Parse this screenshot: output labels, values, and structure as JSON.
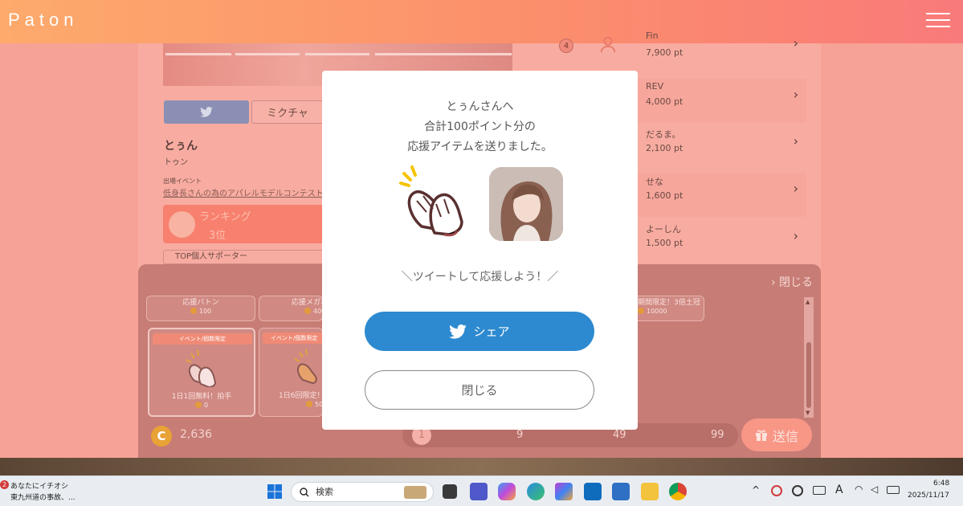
{
  "header": {
    "logo": "Paton"
  },
  "profile": {
    "mixch_label": "ミクチャ",
    "name": "とぅん",
    "name_kana": "トゥン",
    "event_label": "出場イベント",
    "event_link": "低身長さんの為のアパレルモデルコンテスト",
    "rank_title": "ランキング",
    "rank_value": "3位",
    "supporter_label": "TOP個人サポーター"
  },
  "ranking": [
    {
      "num": "4",
      "name": "Fin",
      "pt": "7,900 pt"
    },
    {
      "num": "",
      "name": "REV",
      "pt": "4,000 pt"
    },
    {
      "num": "",
      "name": "だるま。",
      "pt": "2,100 pt"
    },
    {
      "num": "",
      "name": "せな",
      "pt": "1,600 pt"
    },
    {
      "num": "",
      "name": "よーしん",
      "pt": "1,500 pt"
    }
  ],
  "panel": {
    "close_label": "閉じる",
    "items": [
      {
        "name": "応援バトン",
        "cost": "100"
      },
      {
        "name": "応援メガホン",
        "cost": "400"
      },
      {
        "name": "期間限定！3倍土冠",
        "cost": "10000"
      },
      {
        "name": "1日1回無料！拍手",
        "cost": "0",
        "tag": "イベント/個数限定"
      },
      {
        "name": "1日6回限定！",
        "cost": "50",
        "tag": "イベント/個数限定"
      }
    ],
    "balance": "2,636",
    "coin_symbol": "C",
    "quantities": [
      "1",
      "9",
      "49",
      "99"
    ],
    "send_label": "送信"
  },
  "modal": {
    "line1": "とぅんさんへ",
    "line2": "合計100ポイント分の",
    "line3": "応援アイテムを送りました。",
    "tweet_prompt": "＼ツイートして応援しよう！／",
    "share_label": "シェア",
    "close_label": "閉じる"
  },
  "taskbar": {
    "news_badge": "2",
    "news_title": "あなたにイチオシ",
    "news_sub": "東九州道の事故、...",
    "search_placeholder": "検索",
    "ime": "A",
    "time": "6:48",
    "date": "2025/11/17"
  }
}
